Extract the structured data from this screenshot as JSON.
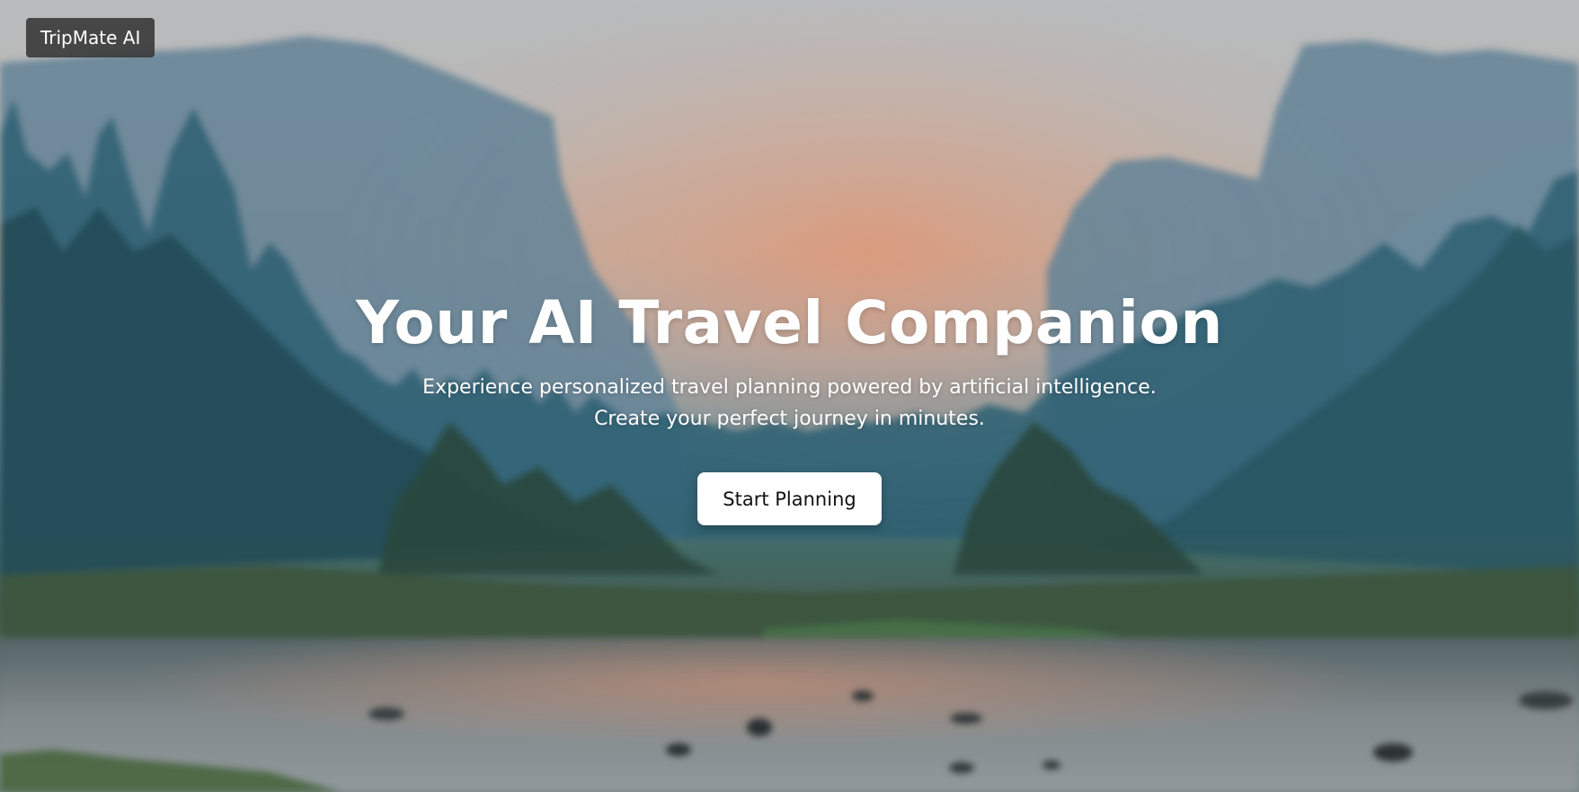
{
  "header": {
    "brand_label": "TripMate AI"
  },
  "hero": {
    "title": "Your AI Travel Companion",
    "subtitle_line1": "Experience personalized travel planning powered by artificial intelligence.",
    "subtitle_line2": "Create your perfect journey in minutes.",
    "cta_label": "Start Planning"
  },
  "colors": {
    "brand_bg": "#3c3c3c",
    "text": "#ffffff",
    "button_bg": "#ffffff",
    "button_text": "#111111"
  }
}
